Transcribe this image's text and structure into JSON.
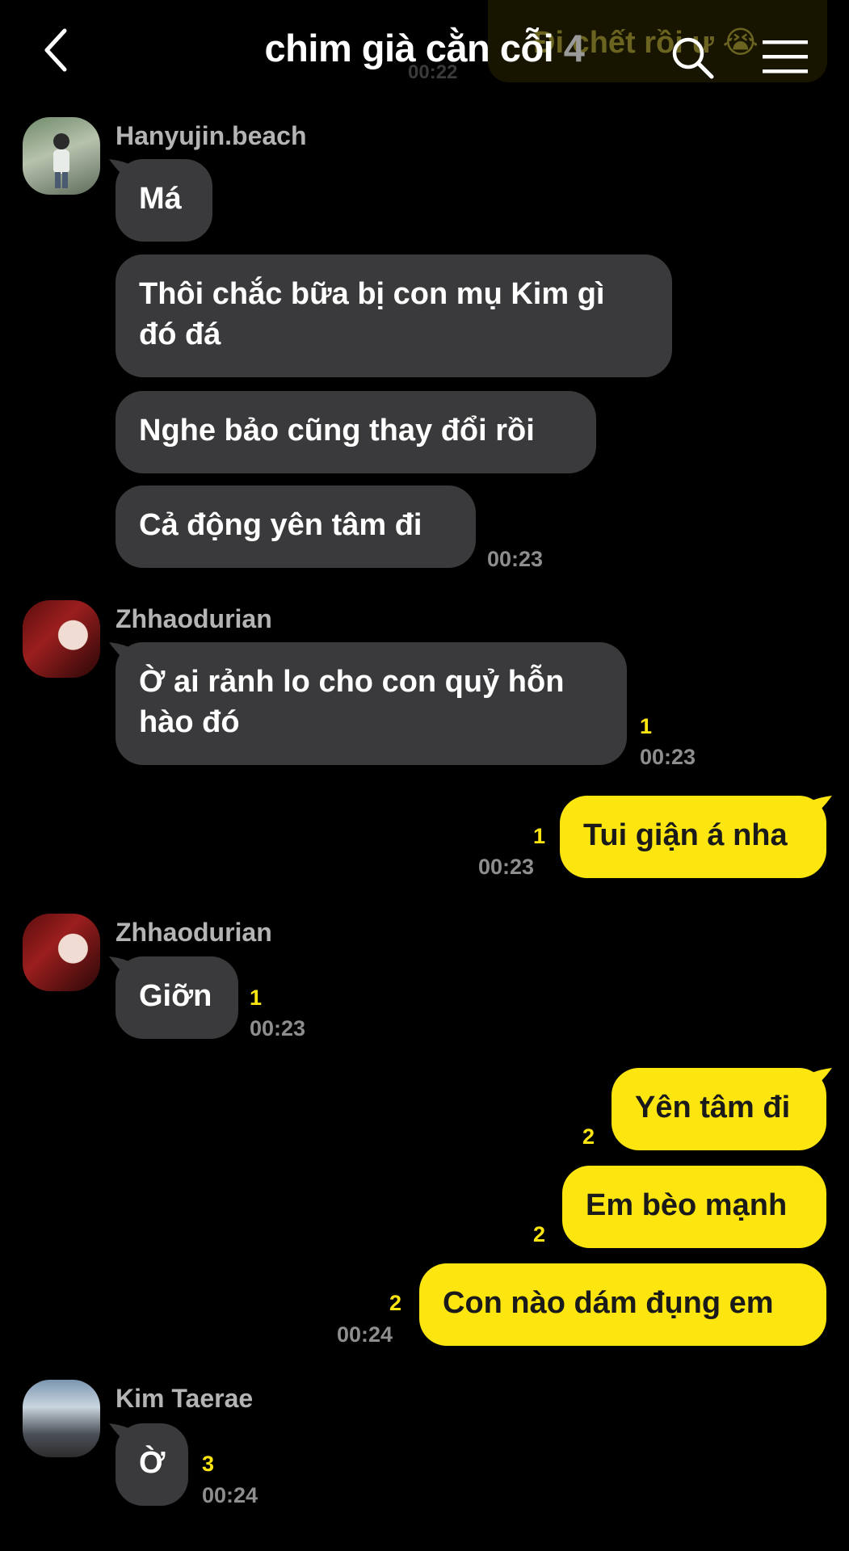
{
  "header": {
    "title": "chim già cằn cỗi",
    "member_count": "4",
    "ghost_text": "Đi chết rồi ư 😭",
    "ghost_time": "00:22"
  },
  "messages": [
    {
      "sender": "Hanyujin.beach",
      "text": "Má"
    },
    {
      "sender": "Hanyujin.beach",
      "text": "Thôi chắc bữa bị con mụ Kim gì đó đá"
    },
    {
      "sender": "Hanyujin.beach",
      "text": "Nghe bảo cũng thay đổi rồi"
    },
    {
      "sender": "Hanyujin.beach",
      "text": "Cả động yên tâm đi",
      "time": "00:23"
    },
    {
      "sender": "Zhhaodurian",
      "text": "Ờ ai rảnh lo cho con quỷ hỗn hào đó",
      "unread": "1",
      "time": "00:23"
    },
    {
      "sender": "me",
      "text": "Tui giận á nha",
      "unread": "1",
      "time": "00:23"
    },
    {
      "sender": "Zhhaodurian",
      "text": "Giỡn",
      "unread": "1",
      "time": "00:23"
    },
    {
      "sender": "me",
      "text": "Yên tâm đi",
      "unread": "2"
    },
    {
      "sender": "me",
      "text": "Em bèo mạnh",
      "unread": "2"
    },
    {
      "sender": "me",
      "text": "Con nào dám đụng em",
      "unread": "2",
      "time": "00:24"
    },
    {
      "sender": "Kim Taerae",
      "text": "Ờ",
      "unread": "3",
      "time": "00:24"
    }
  ],
  "colors": {
    "background": "#000000",
    "incoming_bubble": "#3a3a3c",
    "outgoing_bubble": "#fde510",
    "unread": "#fde510",
    "muted": "#8e8e8e"
  },
  "icons": [
    "back-arrow-icon",
    "search-icon",
    "menu-icon"
  ]
}
